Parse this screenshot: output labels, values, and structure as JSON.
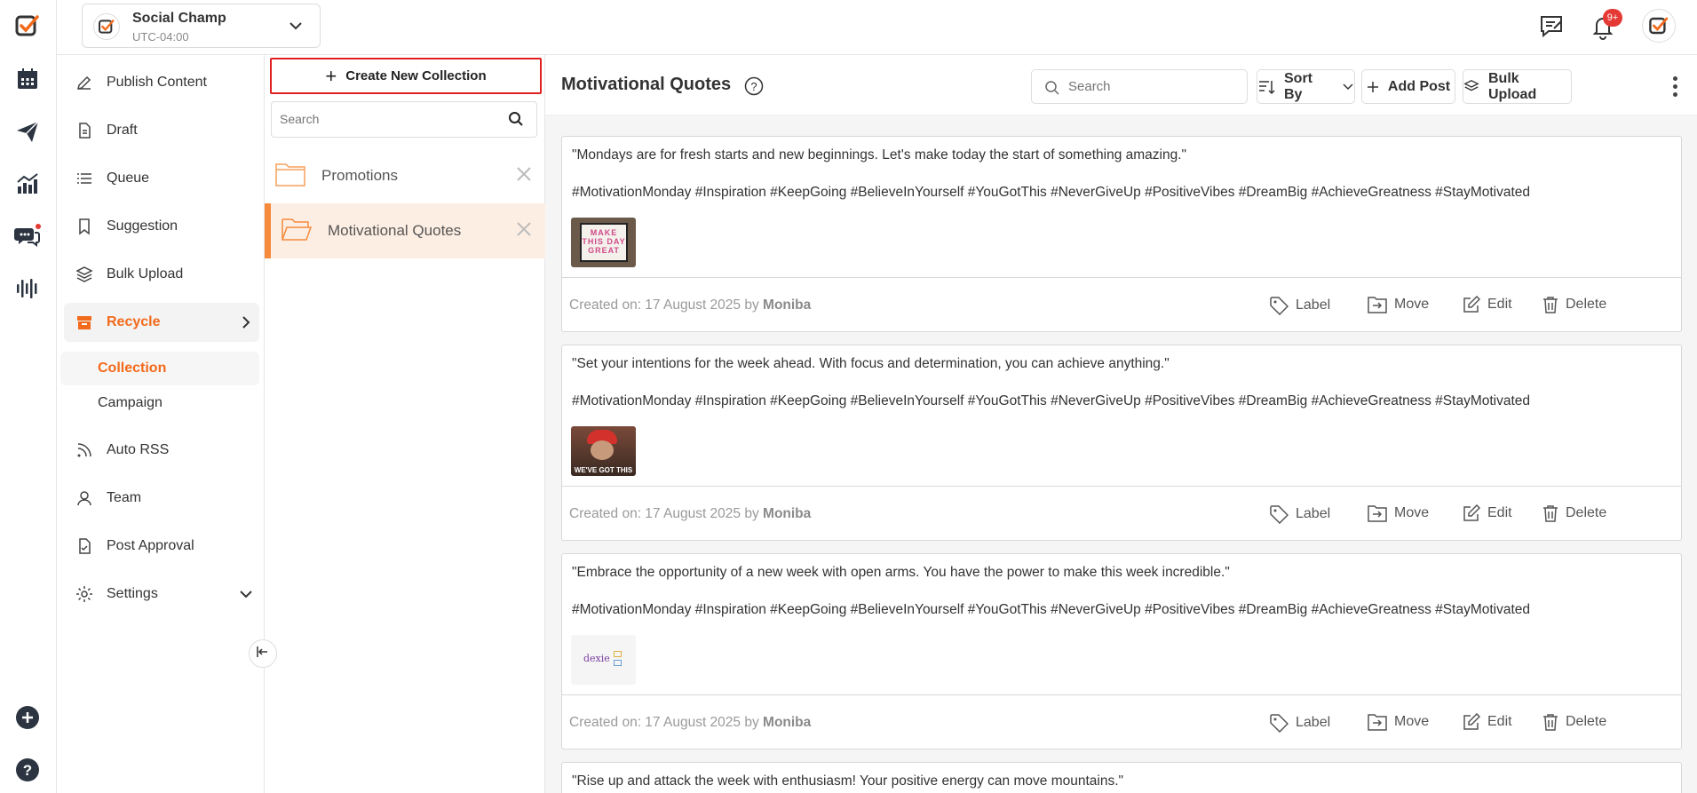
{
  "workspace": {
    "name": "Social Champ",
    "timezone": "UTC-04:00"
  },
  "notifications": {
    "badge": "9+"
  },
  "menu": {
    "items": [
      {
        "label": "Publish Content"
      },
      {
        "label": "Draft"
      },
      {
        "label": "Queue"
      },
      {
        "label": "Suggestion"
      },
      {
        "label": "Bulk Upload"
      },
      {
        "label": "Recycle"
      },
      {
        "label": "Auto RSS"
      },
      {
        "label": "Team"
      },
      {
        "label": "Post Approval"
      },
      {
        "label": "Settings"
      }
    ],
    "recycle_sub": [
      {
        "label": "Collection"
      },
      {
        "label": "Campaign"
      }
    ]
  },
  "collections": {
    "create_label": "Create New Collection",
    "search_placeholder": "Search",
    "items": [
      {
        "label": "Promotions"
      },
      {
        "label": "Motivational Quotes"
      }
    ]
  },
  "main": {
    "title": "Motivational Quotes",
    "search_placeholder": "Search",
    "sort_label": "Sort By",
    "add_post_label": "Add Post",
    "bulk_upload_label": "Bulk Upload"
  },
  "actions": {
    "label": "Label",
    "move": "Move",
    "edit": "Edit",
    "delete": "Delete"
  },
  "posts": [
    {
      "text": "\"Mondays are for fresh starts and new beginnings. Let's make today the start of something amazing.\"",
      "tags": "#MotivationMonday #Inspiration #KeepGoing #BelieveInYourself #YouGotThis #NeverGiveUp #PositiveVibes #DreamBig #AchieveGreatness #StayMotivated",
      "created": "Created on: 17 August 2025 by",
      "author": "Moniba",
      "thumb_text": "MAKE THIS DAY GREAT"
    },
    {
      "text": "\"Set your intentions for the week ahead. With focus and determination, you can achieve anything.\"",
      "tags": "#MotivationMonday #Inspiration #KeepGoing #BelieveInYourself #YouGotThis #NeverGiveUp #PositiveVibes #DreamBig #AchieveGreatness #StayMotivated",
      "created": "Created on: 17 August 2025 by",
      "author": "Moniba",
      "thumb_text": "WE'VE GOT THIS"
    },
    {
      "text": "\"Embrace the opportunity of a new week with open arms. You have the power to make this week incredible.\"",
      "tags": "#MotivationMonday #Inspiration #KeepGoing #BelieveInYourself #YouGotThis #NeverGiveUp #PositiveVibes #DreamBig #AchieveGreatness #StayMotivated",
      "created": "Created on: 17 August 2025 by",
      "author": "Moniba",
      "thumb_text": "dexie"
    },
    {
      "text": "\"Rise up and attack the week with enthusiasm! Your positive energy can move mountains.\""
    }
  ],
  "colors": {
    "accent": "#f26a1b",
    "highlight_border": "#e0201f",
    "active_collection_bg": "#fdeee3"
  }
}
